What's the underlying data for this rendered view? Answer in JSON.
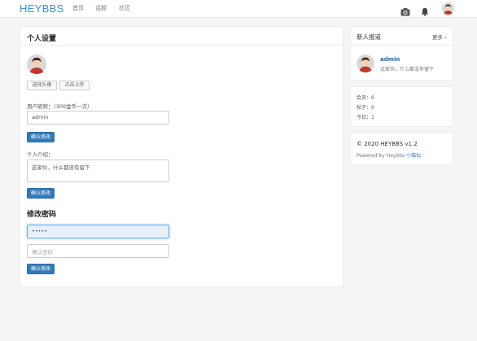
{
  "navbar": {
    "brand": "HEYBBS",
    "links": [
      "首页",
      "话题",
      "社区"
    ],
    "icons": [
      "camera-icon",
      "bell-icon"
    ]
  },
  "settings": {
    "title": "个人设置",
    "choose_avatar": "选择头像",
    "upload_avatar": "点击上传",
    "nickname_label": "用户昵称：（300金币一次）",
    "nickname_value": "admin",
    "nickname_button": "确认修改",
    "bio_label": "个人介绍：",
    "bio_value": "这家伙，什么都没有留下",
    "bio_button": "确认修改",
    "password_title": "修改密码",
    "password_value": "•••••",
    "password_confirm_placeholder": "确认密码",
    "password_button": "确认修改"
  },
  "new_users": {
    "title": "新人报道",
    "more": "更多 ›",
    "user_name": "admin",
    "user_bio": "这家伙，什么都没有留下"
  },
  "stats": {
    "members": "会员：0",
    "posts": "帖子：0",
    "today": "今日：1"
  },
  "footer": {
    "copyright": "© 2020 HEYBBS v1.2",
    "powered_prefix": "Powered by Heybbs ",
    "powered_link": "小猫仙"
  },
  "colors": {
    "brand": "#3c8dd3",
    "primary_button": "#337ab7",
    "page_background": "#f5f5f5"
  }
}
